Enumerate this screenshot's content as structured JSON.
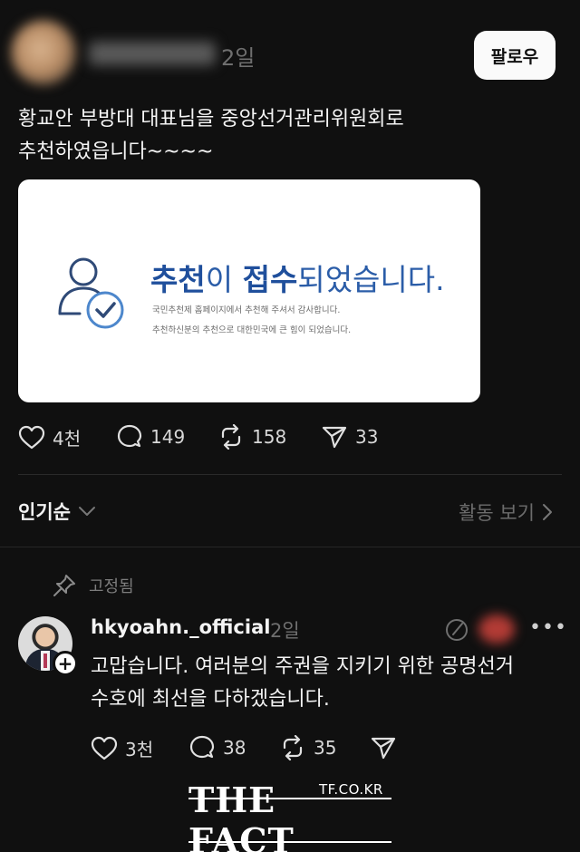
{
  "post": {
    "time": "2일",
    "follow_label": "팔로우",
    "text_lines": [
      "황교안 부방대 대표님을 중앙선거관리위원회로",
      "추천하였읍니다~~~~"
    ],
    "card": {
      "title_bold1": "추천",
      "title_mid": "이 ",
      "title_bold2": "접수",
      "title_end": "되었습니다.",
      "line1": "국민추천제 홈페이지에서 추천해 주셔서 감사합니다.",
      "line2": "추천하신분의 추천으로 대한민국에 큰 힘이 되었습니다."
    },
    "likes": "4천",
    "comments": "149",
    "reposts": "158",
    "shares": "33"
  },
  "sort": {
    "label": "인기순",
    "activity_link": "활동 보기"
  },
  "pinned": {
    "label": "고정됨"
  },
  "comment": {
    "username": "hkyoahn._official",
    "time": "2일",
    "text_lines": [
      "고맙습니다. 여러분의 주권을 지키기 위한 공명선거",
      "수호에 최선을 다하겠습니다."
    ],
    "likes": "3천",
    "comments": "38",
    "reposts": "35",
    "more": "•••"
  },
  "watermark": {
    "site": "TF.CO.KR",
    "logo": "THE FACT"
  },
  "colors": {
    "background": "#101010",
    "card_accent": "#2b5da8",
    "muted": "#6f6f6f"
  },
  "icons": [
    "heart-icon",
    "comment-icon",
    "repost-icon",
    "share-icon",
    "chevron-down-icon",
    "chevron-right-icon",
    "pin-icon",
    "edit-icon",
    "user-check-icon"
  ]
}
